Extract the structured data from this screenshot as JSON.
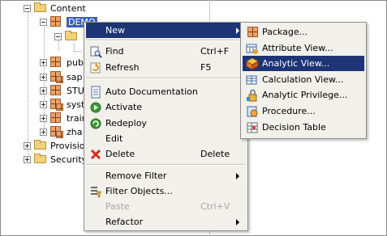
{
  "tree": {
    "root_label": "Content",
    "selected_label": "DEMO",
    "items": [
      {
        "label": "publ"
      },
      {
        "label": "sap"
      },
      {
        "label": "STU"
      },
      {
        "label": "syst"
      },
      {
        "label": "train"
      },
      {
        "label": "zha"
      }
    ],
    "bottom_items": [
      {
        "label": "Provision"
      },
      {
        "label": "Security"
      }
    ]
  },
  "context_menu": {
    "items": [
      {
        "label": "New",
        "shortcut": "",
        "icon": "none",
        "submenu": true
      },
      {
        "label": "Find",
        "shortcut": "Ctrl+F",
        "icon": "find-icon"
      },
      {
        "label": "Refresh",
        "shortcut": "F5",
        "icon": "refresh-icon"
      },
      {
        "label": "Auto Documentation",
        "shortcut": "",
        "icon": "document-icon"
      },
      {
        "label": "Activate",
        "shortcut": "",
        "icon": "activate-icon"
      },
      {
        "label": "Redeploy",
        "shortcut": "",
        "icon": "redeploy-icon"
      },
      {
        "label": "Edit",
        "shortcut": "",
        "icon": "none"
      },
      {
        "label": "Delete",
        "shortcut": "Delete",
        "icon": "delete-icon"
      },
      {
        "label": "Remove Filter",
        "shortcut": "",
        "icon": "none",
        "submenu": true
      },
      {
        "label": "Filter Objects...",
        "shortcut": "",
        "icon": "filter-icon"
      },
      {
        "label": "Paste",
        "shortcut": "Ctrl+V",
        "icon": "none",
        "disabled": true
      },
      {
        "label": "Refactor",
        "shortcut": "",
        "icon": "none",
        "submenu": true
      }
    ]
  },
  "submenu": {
    "items": [
      {
        "label": "Package...",
        "icon": "package-icon"
      },
      {
        "label": "Attribute View...",
        "icon": "attribute-view-icon"
      },
      {
        "label": "Analytic View...",
        "icon": "analytic-view-icon"
      },
      {
        "label": "Calculation View...",
        "icon": "calculation-view-icon"
      },
      {
        "label": "Analytic Privilege...",
        "icon": "analytic-privilege-icon"
      },
      {
        "label": "Procedure...",
        "icon": "procedure-icon"
      },
      {
        "label": "Decision Table",
        "icon": "decision-table-icon"
      }
    ]
  },
  "colors": {
    "highlight": "#1d3475",
    "selection": "#3d5eb5",
    "menu_bg": "#f1f0ea",
    "disabled_text": "#a6a6a6"
  }
}
